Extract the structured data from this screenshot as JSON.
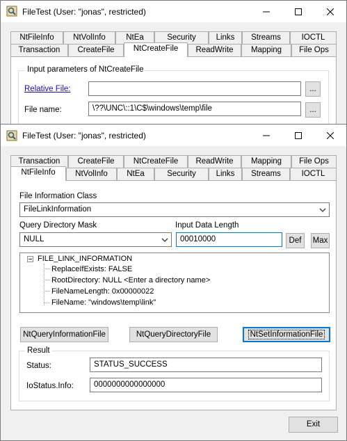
{
  "back_window": {
    "title": "FileTest (User: \"jonas\", restricted)",
    "tabs_row1": [
      "NtFileInfo",
      "NtVolInfo",
      "NtEa",
      "Security",
      "Links",
      "Streams",
      "IOCTL"
    ],
    "tabs_row2": [
      "Transaction",
      "CreateFile",
      "NtCreateFile",
      "ReadWrite",
      "Mapping",
      "File Ops"
    ],
    "active_tab": "NtCreateFile",
    "group_title": "Input parameters of NtCreateFile",
    "relative_file_label": "Relative File:",
    "relative_file_value": "",
    "file_name_label": "File name:",
    "file_name_value": "\\??\\UNC\\::1\\C$\\windows\\temp\\file",
    "browse_label": "..."
  },
  "front_window": {
    "title": "FileTest (User: \"jonas\", restricted)",
    "tabs_row1": [
      "Transaction",
      "CreateFile",
      "NtCreateFile",
      "ReadWrite",
      "Mapping",
      "File Ops"
    ],
    "tabs_row2": [
      "NtFileInfo",
      "NtVolInfo",
      "NtEa",
      "Security",
      "Links",
      "Streams",
      "IOCTL"
    ],
    "active_tab": "NtFileInfo",
    "file_info_class_label": "File Information Class",
    "file_info_class_value": "FileLinkInformation",
    "query_dir_mask_label": "Query Directory Mask",
    "query_dir_mask_value": "NULL",
    "input_data_length_label": "Input Data Length",
    "input_data_length_value": "00010000",
    "def_button": "Def",
    "max_button": "Max",
    "tree": {
      "root": "FILE_LINK_INFORMATION",
      "children": [
        "ReplaceIfExists: FALSE",
        "RootDirectory: NULL <Enter a directory name>",
        "FileNameLength: 0x00000022",
        "FileName: \"windows\\temp\\link\""
      ]
    },
    "buttons": {
      "query_info": "NtQueryInformationFile",
      "query_dir": "NtQueryDirectoryFile",
      "set_info": "NtSetInformationFile"
    },
    "result": {
      "title": "Result",
      "status_label": "Status:",
      "status_value": "STATUS_SUCCESS",
      "iostatus_label": "IoStatus.Info:",
      "iostatus_value": "0000000000000000"
    },
    "exit_button": "Exit"
  },
  "icons": {
    "app": "app-icon",
    "minimize": "minimize-icon",
    "maximize": "maximize-icon",
    "close": "close-icon",
    "dropdown": "chevron-down-icon"
  }
}
